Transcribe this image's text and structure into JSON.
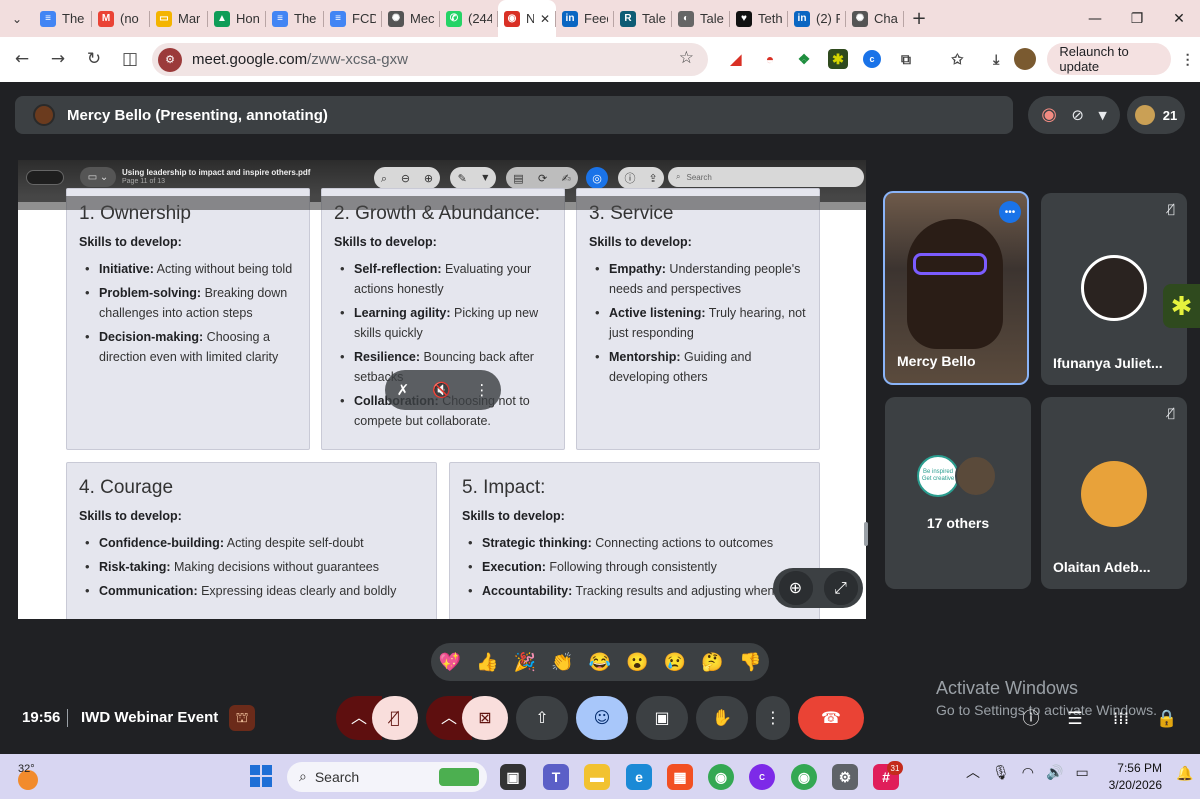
{
  "browser": {
    "tabs": [
      {
        "label": "The",
        "icon": "docs-icon",
        "color": "#4285f4",
        "glyph": "≡"
      },
      {
        "label": "(no",
        "icon": "gmail-icon",
        "color": "#ea4335",
        "glyph": "M"
      },
      {
        "label": "Mar",
        "icon": "slides-icon",
        "color": "#f4b400",
        "glyph": "▭"
      },
      {
        "label": "Hon",
        "icon": "drive-icon",
        "color": "#0f9d58",
        "glyph": "▲"
      },
      {
        "label": "The",
        "icon": "docs-icon",
        "color": "#4285f4",
        "glyph": "≡"
      },
      {
        "label": "FCD",
        "icon": "docs-icon",
        "color": "#4285f4",
        "glyph": "≡"
      },
      {
        "label": "Mec",
        "icon": "openai-icon",
        "color": "#555555",
        "glyph": "✺"
      },
      {
        "label": "(244",
        "icon": "whatsapp-icon",
        "color": "#25d366",
        "glyph": "✆"
      },
      {
        "label": "N",
        "icon": "record-icon",
        "color": "#d93025",
        "glyph": "◉",
        "active": true
      },
      {
        "label": "Feed",
        "icon": "linkedin-icon",
        "color": "#0a66c2",
        "glyph": "in"
      },
      {
        "label": "Tale",
        "icon": "r-icon",
        "color": "#0d5c75",
        "glyph": "R"
      },
      {
        "label": "Tale",
        "icon": "globe-icon",
        "color": "#666666",
        "glyph": "◐"
      },
      {
        "label": "Teth",
        "icon": "heart-icon",
        "color": "#111111",
        "glyph": "♥"
      },
      {
        "label": "(2) F",
        "icon": "linkedin-icon",
        "color": "#0a66c2",
        "glyph": "in"
      },
      {
        "label": "Cha",
        "icon": "openai-icon",
        "color": "#555555",
        "glyph": "✺"
      }
    ],
    "url_host": "meet.google.com",
    "url_path": "/zww-xcsa-gxw",
    "relaunch_label": "Relaunch to update"
  },
  "meet": {
    "presenter_label": "Mercy Bello (Presenting, annotating)",
    "participant_count": "21",
    "time": "19:56",
    "meeting_title": "IWD Webinar Event",
    "pdf": {
      "title": "Using leadership to impact and inspire others.pdf",
      "page": "Page 11 of 13",
      "search_placeholder": "Search"
    },
    "cards": [
      {
        "title": "1. Ownership",
        "subtitle": "Skills to develop:",
        "items": [
          {
            "term": "Initiative:",
            "desc": " Acting without being told"
          },
          {
            "term": "Problem-solving:",
            "desc": " Breaking down challenges into action steps"
          },
          {
            "term": "Decision-making:",
            "desc": " Choosing a direction even with limited clarity"
          }
        ]
      },
      {
        "title": "2. Growth & Abundance:",
        "subtitle": "Skills to develop:",
        "items": [
          {
            "term": "Self-reflection:",
            "desc": " Evaluating your actions honestly"
          },
          {
            "term": "Learning agility:",
            "desc": " Picking up new skills quickly"
          },
          {
            "term": "Resilience:",
            "desc": " Bouncing back after setbacks"
          },
          {
            "term": "Collaboration:",
            "desc": " Choosing not to compete but collaborate."
          }
        ]
      },
      {
        "title": "3. Service",
        "subtitle": "Skills to develop:",
        "items": [
          {
            "term": "Empathy:",
            "desc": " Understanding people's needs and perspectives"
          },
          {
            "term": "Active listening:",
            "desc": " Truly hearing, not just responding"
          },
          {
            "term": "Mentorship:",
            "desc": " Guiding and developing others"
          }
        ]
      },
      {
        "title": "4. Courage",
        "subtitle": "Skills to develop:",
        "items": [
          {
            "term": "Confidence-building:",
            "desc": " Acting despite self-doubt"
          },
          {
            "term": "Risk-taking:",
            "desc": " Making decisions without guarantees"
          },
          {
            "term": "Communication:",
            "desc": " Expressing ideas clearly and boldly"
          }
        ]
      },
      {
        "title": "5. Impact:",
        "subtitle": "Skills to develop:",
        "items": [
          {
            "term": "Strategic thinking:",
            "desc": " Connecting actions to outcomes"
          },
          {
            "term": "Execution:",
            "desc": " Following through consistently"
          },
          {
            "term": "Accountability:",
            "desc": " Tracking results and adjusting when"
          }
        ]
      }
    ],
    "participants": {
      "speaker": "Mercy Bello",
      "tile2": "Ifunanya Juliet...",
      "others": "17 others",
      "tile4": "Olaitan Adeb...",
      "others_badge_text": "Be inspired Get creative"
    },
    "reactions": [
      "💖",
      "👍",
      "🎉",
      "👏",
      "😂",
      "😮",
      "😢",
      "🤔",
      "👎"
    ],
    "activate_title": "Activate Windows",
    "activate_sub": "Go to Settings to activate Windows."
  },
  "taskbar": {
    "temperature": "32°",
    "search_label": "Search",
    "time": "7:56 PM",
    "date": "3/20/2026",
    "badge_count": "31"
  },
  "colors": {
    "meet_bg": "#202124",
    "end_call": "#ea4335",
    "alert": "#f9dedc",
    "accent_blue": "#a8c7fa"
  }
}
